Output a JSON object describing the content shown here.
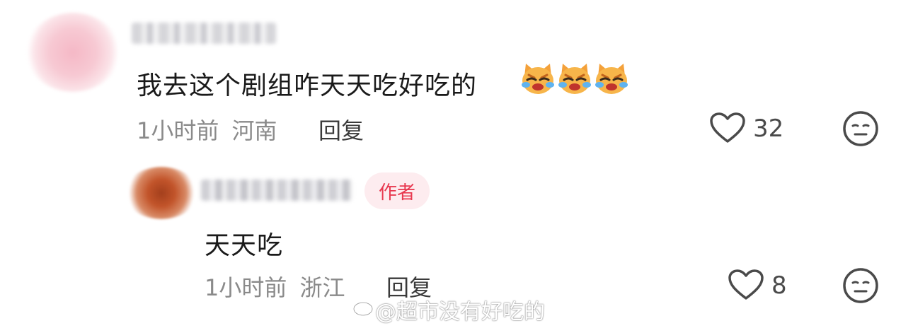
{
  "comments": [
    {
      "text": "我去这个剧组咋天天吃好吃的",
      "emojis": [
        "crying-cat-icon",
        "crying-cat-icon",
        "crying-cat-icon"
      ],
      "time": "1小时前",
      "location": "河南",
      "reply_label": "回复",
      "likes": "32"
    },
    {
      "badge": "作者",
      "text": "天天吃",
      "time": "1小时前",
      "location": "浙江",
      "reply_label": "回复",
      "likes": "8"
    }
  ],
  "watermark": "@超市没有好吃的",
  "icons": {
    "like": "heart-outline-icon",
    "dislike": "meh-face-icon",
    "watermark_logo": "weibo-logo-icon"
  },
  "colors": {
    "badge_text": "#e8384f",
    "badge_bg": "#fdecef",
    "meta_text": "#8a8a8a"
  }
}
